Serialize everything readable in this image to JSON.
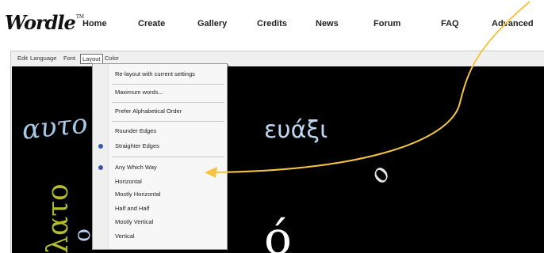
{
  "logo": {
    "text": "Wordle",
    "tm": "TM"
  },
  "nav": [
    {
      "label": "Home"
    },
    {
      "label": "Create"
    },
    {
      "label": "Gallery"
    },
    {
      "label": "Credits"
    },
    {
      "label": "News"
    },
    {
      "label": "Forum"
    },
    {
      "label": "FAQ"
    },
    {
      "label": "Advanced"
    }
  ],
  "menubar": [
    {
      "label": "Edit"
    },
    {
      "label": "Language"
    },
    {
      "label": "Font"
    },
    {
      "label": "Layout"
    },
    {
      "label": "Color"
    }
  ],
  "layout_menu": {
    "relayout": "Re-layout with current settings",
    "max_words": "Maximum words...",
    "alphabetical": "Prefer Alphabetical Order",
    "edges": [
      "Rounder Edges",
      "Straighter Edges"
    ],
    "edges_selected": "Straighter Edges",
    "orientations": [
      "Any Which Way",
      "Horizontal",
      "Mostly Horizontal",
      "Half and Half",
      "Mostly Vertical",
      "Vertical"
    ],
    "orientation_selected": "Any Which Way"
  },
  "cloud_words": [
    "αυτο",
    "λατο",
    "ο",
    "ευάξι",
    "ο",
    "ó"
  ],
  "colors": {
    "arrow": "#f5c542",
    "canvas": "#000000",
    "radio": "#3a56a8"
  }
}
